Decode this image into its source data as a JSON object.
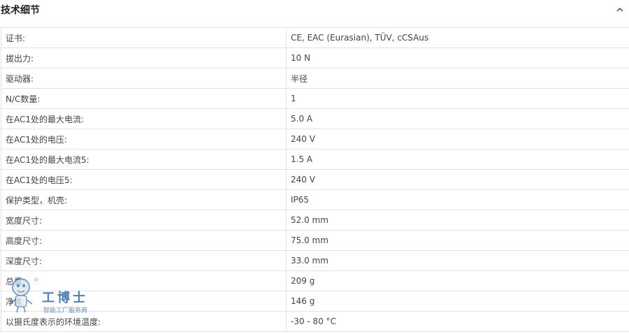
{
  "section": {
    "title": "技术细节"
  },
  "specs": [
    {
      "label": "证书:",
      "value": "CE, EAC (Eurasian), TÜV, cCSAus"
    },
    {
      "label": "拔出力:",
      "value": "10 N"
    },
    {
      "label": "驱动器:",
      "value": "半径"
    },
    {
      "label": "N/C数量:",
      "value": "1"
    },
    {
      "label": "在AC1处的最大电流:",
      "value": "5.0 A"
    },
    {
      "label": "在AC1处的电压:",
      "value": "240 V"
    },
    {
      "label": "在AC1处的最大电流5:",
      "value": "1.5 A"
    },
    {
      "label": "在AC1处的电压5:",
      "value": "240 V"
    },
    {
      "label": "保护类型，机壳:",
      "value": "IP65"
    },
    {
      "label": "宽度尺寸:",
      "value": "52.0 mm"
    },
    {
      "label": "高度尺寸:",
      "value": "75.0 mm"
    },
    {
      "label": "深度尺寸:",
      "value": "33.0 mm"
    },
    {
      "label": "总重:",
      "value": "209 g"
    },
    {
      "label": "净重:",
      "value": "146 g"
    },
    {
      "label": "以摄氏度表示的环境温度:",
      "value": "-30 - 80 °C"
    }
  ],
  "watermark": {
    "brand": "工博士",
    "subtitle": "智能工厂服务商",
    "mark": "®"
  },
  "icons": {
    "collapse": "chevron-up-icon",
    "mascot": "robot-mascot-icon"
  },
  "colors": {
    "border": "#e3e3e3",
    "text": "#444444",
    "brand": "#2f6aa8"
  }
}
